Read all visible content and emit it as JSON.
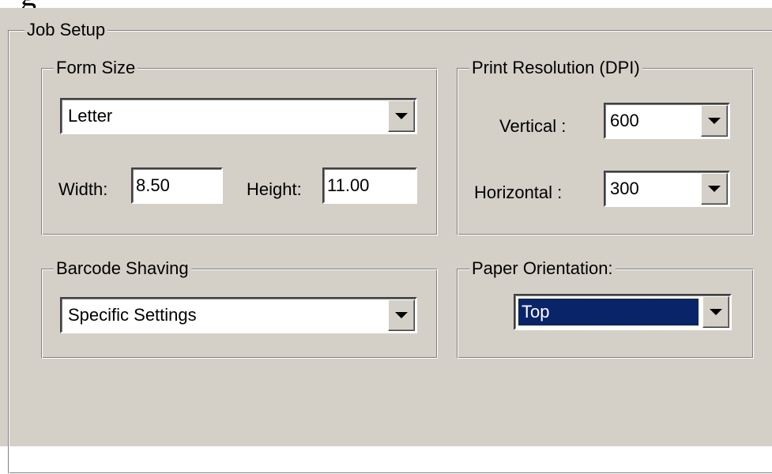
{
  "dialog": {
    "group_title": "Job Setup",
    "form_size": {
      "title": "Form Size",
      "size_value": "Letter",
      "width_label": "Width:",
      "width_value": "8.50",
      "height_label": "Height:",
      "height_value": "11.00"
    },
    "print_resolution": {
      "title": "Print Resolution (DPI)",
      "vertical_label": "Vertical :",
      "vertical_value": "600",
      "horizontal_label": "Horizontal :",
      "horizontal_value": "300"
    },
    "barcode_shaving": {
      "title": "Barcode Shaving",
      "value": "Specific Settings"
    },
    "paper_orientation": {
      "title": "Paper Orientation:",
      "value": "Top"
    }
  },
  "colors": {
    "dialog_bg": "#d4d0c8",
    "selection_bg": "#0a246a",
    "selection_text": "#ffffff"
  },
  "icons": {
    "dropdown": "chevron-down-icon"
  }
}
